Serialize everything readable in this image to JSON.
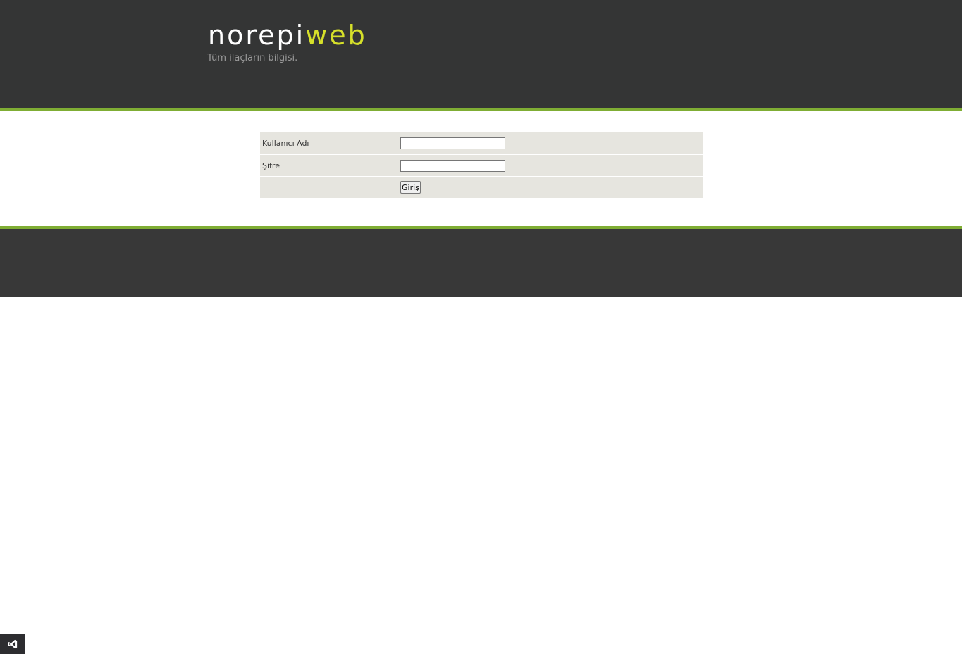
{
  "brand": {
    "name_part1": "norepi",
    "name_part2": "web",
    "tagline": "Tüm ilaçların bilgisi.",
    "colors": {
      "header_bg": "#343535",
      "accent_green": "#7fad34",
      "brand_yellow": "#d6e02a",
      "footer_bg": "#383838",
      "form_bg": "#e6e5df"
    }
  },
  "login_form": {
    "username_label": "Kullanıcı Adı",
    "username_value": "",
    "password_label": "Şifre",
    "password_value": "",
    "submit_label": "Giriş"
  },
  "dev_badge": {
    "icon": "visual-studio-icon"
  }
}
